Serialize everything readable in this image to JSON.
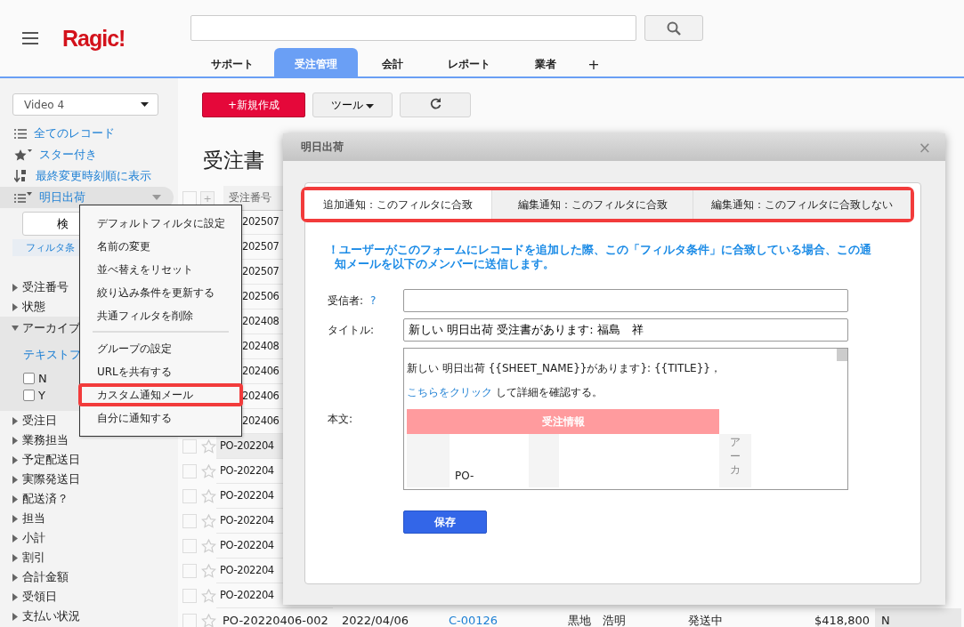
{
  "topbar": {
    "logo": "Ragic!",
    "tabs": [
      {
        "label": "サポート",
        "selected": false
      },
      {
        "label": "受注管理",
        "selected": true
      },
      {
        "label": "会計",
        "selected": false
      },
      {
        "label": "レポート",
        "selected": false
      },
      {
        "label": "業者",
        "selected": false
      }
    ],
    "add_tab": "+"
  },
  "sidebar": {
    "view_select": "Video 4",
    "views": [
      {
        "label": "全てのレコード",
        "kind": "list",
        "selected": false
      },
      {
        "label": "スター付き",
        "kind": "star",
        "selected": false
      },
      {
        "label": "最終変更時刻順に表示",
        "kind": "sort",
        "selected": false
      },
      {
        "label": "明日出荷",
        "kind": "filter",
        "selected": true
      }
    ],
    "search_button": "検",
    "filter_link": "フィルタ条",
    "fields": [
      {
        "label": "受注番号",
        "expanded": false
      },
      {
        "label": "状態",
        "expanded": false
      },
      {
        "label": "アーカイブ",
        "expanded": true,
        "filter_link": "テキストフ",
        "options": [
          {
            "label": "N",
            "checked": false
          },
          {
            "label": "Y",
            "checked": false
          }
        ]
      },
      {
        "label": "受注日",
        "expanded": false
      },
      {
        "label": "業務担当",
        "expanded": false
      },
      {
        "label": "予定配送日",
        "expanded": false
      },
      {
        "label": "実際発送日",
        "expanded": false
      },
      {
        "label": "配送済？",
        "expanded": false
      },
      {
        "label": "担当",
        "expanded": false
      },
      {
        "label": "小計",
        "expanded": false
      },
      {
        "label": "割引",
        "expanded": false
      },
      {
        "label": "合計金額",
        "expanded": false
      },
      {
        "label": "受領日",
        "expanded": false
      },
      {
        "label": "支払い状況",
        "expanded": false
      }
    ]
  },
  "toolbar": {
    "new_button": "+新規作成",
    "tools_button": "ツール"
  },
  "page_title": "受注書",
  "table": {
    "add_column": "+",
    "select_all_checked": false,
    "columns": [
      "受注番号"
    ],
    "rows": [
      {
        "cells": [
          "202507"
        ],
        "highlighted": false
      },
      {
        "cells": [
          "202507"
        ],
        "highlighted": false
      },
      {
        "cells": [
          "202507"
        ],
        "highlighted": false
      },
      {
        "cells": [
          "202506"
        ],
        "highlighted": false
      },
      {
        "cells": [
          "202408"
        ],
        "highlighted": false
      },
      {
        "cells": [
          "202408"
        ],
        "highlighted": false
      },
      {
        "cells": [
          "202406"
        ],
        "highlighted": false
      },
      {
        "cells": [
          "202406"
        ],
        "highlighted": false
      },
      {
        "cells": [
          "202406"
        ],
        "highlighted": false
      },
      {
        "cells": [
          "PO-202204"
        ],
        "highlighted": true,
        "checked": false,
        "starred": false
      },
      {
        "cells": [
          "PO-202204"
        ],
        "highlighted": false,
        "checked": false,
        "starred": false
      },
      {
        "cells": [
          "PO-202204"
        ],
        "highlighted": false,
        "checked": false,
        "starred": false
      },
      {
        "cells": [
          "PO-202204"
        ],
        "highlighted": false,
        "checked": false,
        "starred": false
      },
      {
        "cells": [
          "PO-202204"
        ],
        "highlighted": false,
        "checked": false,
        "starred": false
      },
      {
        "cells": [
          "PO-202204"
        ],
        "highlighted": false,
        "checked": false,
        "starred": false
      },
      {
        "cells": [
          "PO-202204"
        ],
        "highlighted": false,
        "checked": false,
        "starred": false
      },
      {
        "cells": [
          "PO-20220406-002",
          "2022/04/06",
          "C-00126",
          "黒地　浩明",
          "発送中",
          "$418,800",
          "N"
        ],
        "highlighted": false,
        "checked": false,
        "starred": false
      }
    ]
  },
  "context_menu": {
    "groups": [
      [
        {
          "label": "デフォルトフィルタに設定",
          "highlighted": false
        },
        {
          "label": "名前の変更",
          "highlighted": false
        },
        {
          "label": "並べ替えをリセット",
          "highlighted": false
        },
        {
          "label": "絞り込み条件を更新する",
          "highlighted": false
        },
        {
          "label": "共通フィルタを削除",
          "highlighted": false
        }
      ],
      [
        {
          "label": "グループの設定",
          "highlighted": false
        },
        {
          "label": "URLを共有する",
          "highlighted": false
        },
        {
          "label": "カスタム通知メール",
          "highlighted": true
        },
        {
          "label": "自分に通知する",
          "highlighted": false
        }
      ]
    ]
  },
  "dialog": {
    "title": "明日出荷",
    "close": "×",
    "tabs": [
      {
        "label": "追加通知：このフィルタに合致",
        "selected": true
      },
      {
        "label": "編集通知：このフィルタに合致",
        "selected": false
      },
      {
        "label": "編集通知：このフィルタに合致しない",
        "selected": false
      }
    ],
    "notice": "！ユーザーがこのフォームにレコードを追加した際、この「フィルタ条件」に合致している場合、この通知メールを以下のメンバーに送信します。",
    "recipient": {
      "label": "受信者:",
      "help": "?"
    },
    "title_field": {
      "label": "タイトル:",
      "value": "新しい 明日出荷 受注書があります: 福島　祥"
    },
    "body": {
      "label": "本文:",
      "line1": "新しい 明日出荷 {{SHEET_NAME}}があります}: {{TITLE}}，",
      "link": "こちらをクリック",
      "line2": " して詳細を確認する。",
      "table_header": "受注情報",
      "cell_text": "PO-",
      "vertical_text": "アーカ"
    },
    "save_button": "保存"
  }
}
